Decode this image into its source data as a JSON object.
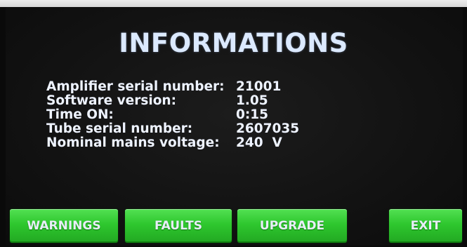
{
  "screen": {
    "title": "INFORMATIONS"
  },
  "info": [
    {
      "label": "Amplifier serial number:",
      "value": "21001"
    },
    {
      "label": "Software version:",
      "value": "1.05"
    },
    {
      "label": "Time ON:",
      "value": "0:15"
    },
    {
      "label": "Tube serial number:",
      "value": "2607035"
    },
    {
      "label": "Nominal mains voltage:",
      "value": "240  V"
    }
  ],
  "buttons": {
    "warnings": "WARNINGS",
    "faults": "FAULTS",
    "upgrade": "UPGRADE",
    "exit": "EXIT"
  },
  "colors": {
    "button_green": "#2ec72e",
    "screen_background": "#121212",
    "title_text": "#dbe9ff",
    "body_text": "#eef3ff"
  }
}
